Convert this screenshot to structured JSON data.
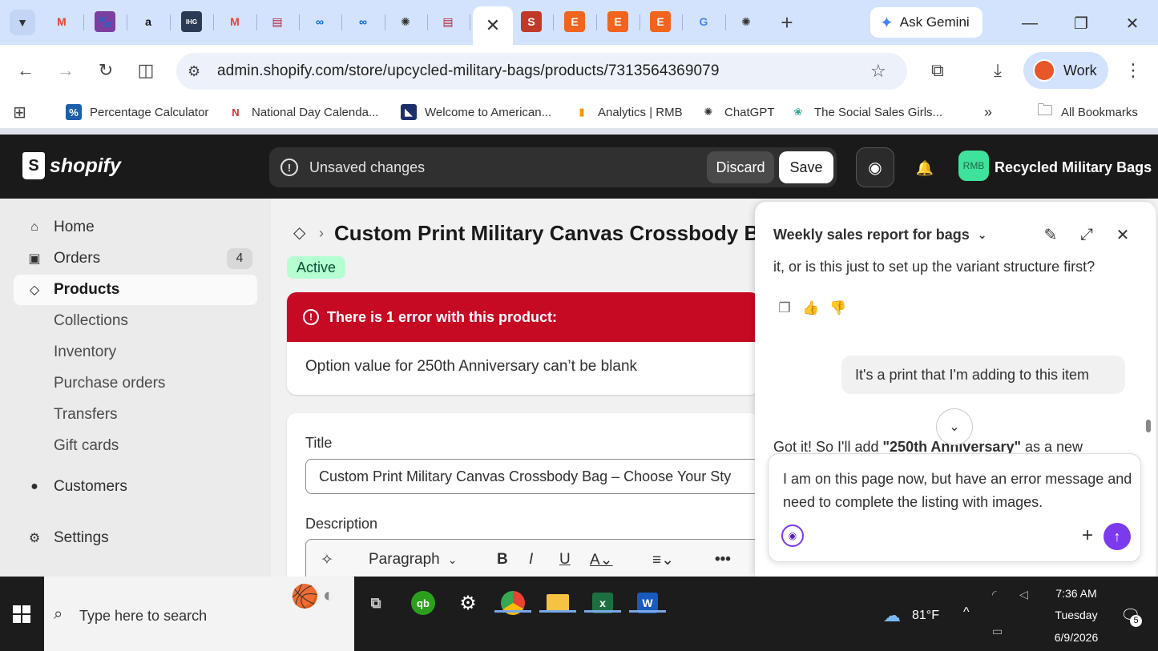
{
  "browser": {
    "tabs": [
      {
        "icon": "gmail-icon",
        "glyph": "M",
        "color": "#ea4335",
        "bg": "transparent"
      },
      {
        "icon": "paw-icon",
        "glyph": "🐾",
        "color": "#fff",
        "bg": "#7b3fa0"
      },
      {
        "icon": "amazon-icon",
        "glyph": "a",
        "color": "#111",
        "bg": "transparent"
      },
      {
        "icon": "ihg-icon",
        "glyph": "IHG",
        "color": "#fff",
        "bg": "#2a3b55"
      },
      {
        "icon": "gmail-icon",
        "glyph": "M",
        "color": "#ea4335",
        "bg": "transparent"
      },
      {
        "icon": "flag-icon",
        "glyph": "▤",
        "color": "#b22234",
        "bg": "transparent"
      },
      {
        "icon": "meta-icon",
        "glyph": "∞",
        "color": "#0668e1",
        "bg": "transparent"
      },
      {
        "icon": "meta-icon",
        "glyph": "∞",
        "color": "#0668e1",
        "bg": "transparent"
      },
      {
        "icon": "chatgpt-icon",
        "glyph": "✺",
        "color": "#333",
        "bg": "transparent"
      },
      {
        "icon": "flag-icon",
        "glyph": "▤",
        "color": "#b22234",
        "bg": "transparent"
      },
      {
        "icon": "close-icon",
        "glyph": "✕",
        "color": "#333",
        "bg": "transparent"
      },
      {
        "icon": "s-icon",
        "glyph": "S",
        "color": "#fff",
        "bg": "#c0392b"
      },
      {
        "icon": "etsy-icon",
        "glyph": "E",
        "color": "#fff",
        "bg": "#f1641e"
      },
      {
        "icon": "etsy-icon",
        "glyph": "E",
        "color": "#fff",
        "bg": "#f1641e"
      },
      {
        "icon": "etsy-icon",
        "glyph": "E",
        "color": "#fff",
        "bg": "#f1641e"
      },
      {
        "icon": "google-icon",
        "glyph": "G",
        "color": "#4285f4",
        "bg": "transparent"
      },
      {
        "icon": "chatgpt-icon",
        "glyph": "✺",
        "color": "#333",
        "bg": "transparent"
      }
    ],
    "gemini_label": "Ask Gemini",
    "url": "admin.shopify.com/store/upcycled-military-bags/products/7313564369079",
    "profile_label": "Work",
    "bookmarks": [
      {
        "label": "Percentage Calculator",
        "icon": "percent-icon",
        "glyph": "%",
        "color": "#fff",
        "bg": "#1d5ea8"
      },
      {
        "label": "National Day Calenda...",
        "icon": "national-day-icon",
        "glyph": "N",
        "color": "#d32f2f",
        "bg": "transparent"
      },
      {
        "label": "Welcome to American...",
        "icon": "american-icon",
        "glyph": "◣",
        "color": "#fff",
        "bg": "#1b2f6b"
      },
      {
        "label": "Analytics | RMB",
        "icon": "analytics-icon",
        "glyph": "▮",
        "color": "#f29900",
        "bg": "transparent"
      },
      {
        "label": "ChatGPT",
        "icon": "chatgpt-icon",
        "glyph": "✺",
        "color": "#333",
        "bg": "transparent"
      },
      {
        "label": "The Social Sales Girls...",
        "icon": "social-sales-icon",
        "glyph": "❀",
        "color": "#2aa198",
        "bg": "transparent"
      }
    ],
    "all_bookmarks_label": "All Bookmarks"
  },
  "shopify": {
    "logo_text": "shopify",
    "unsaved_label": "Unsaved changes",
    "discard_label": "Discard",
    "save_label": "Save",
    "store_initials": "RMB",
    "store_name": "Recycled Military Bags",
    "accent": "#3fe29c"
  },
  "sidebar": {
    "items": [
      {
        "label": "Home",
        "icon": "home-icon",
        "glyph": "⌂"
      },
      {
        "label": "Orders",
        "icon": "orders-icon",
        "glyph": "▣",
        "badge": "4"
      },
      {
        "label": "Products",
        "icon": "tag-icon",
        "glyph": "◇"
      },
      {
        "label": "Collections"
      },
      {
        "label": "Inventory"
      },
      {
        "label": "Purchase orders"
      },
      {
        "label": "Transfers"
      },
      {
        "label": "Gift cards"
      },
      {
        "label": "Customers",
        "icon": "person-icon",
        "glyph": "👤"
      },
      {
        "label": "Settings",
        "icon": "gear-icon",
        "glyph": "⚙"
      }
    ]
  },
  "product": {
    "title": "Custom Print Military Canvas Crossbody Bag",
    "status": "Active",
    "error_heading": "There is 1 error with this product:",
    "error_message": "Option value for 250th Anniversary can’t be blank",
    "title_label": "Title",
    "title_value": "Custom Print Military Canvas Crossbody Bag – Choose Your Sty",
    "description_label": "Description",
    "editor": {
      "paragraph_label": "Paragraph"
    }
  },
  "sidekick": {
    "conversation_title": "Weekly sales report for bags",
    "assistant_prev_line": "it, or is this just to set up the variant structure first?",
    "user_message": "It's a print that I'm adding to this item",
    "assistant_reply_start": "Got it! So I'll add ",
    "assistant_reply_bold": "\"250th Anniversary\"",
    "assistant_reply_end": " as a new",
    "compose_text": "I am on this page now, but have an error message and need to complete the listing with images.",
    "send_color": "#7c3aed"
  },
  "taskbar": {
    "search_placeholder": "Type here to search",
    "weather": "81°F",
    "time": "7:36 AM",
    "day": "Tuesday",
    "date": "6/9/2026",
    "notification_count": "5"
  }
}
